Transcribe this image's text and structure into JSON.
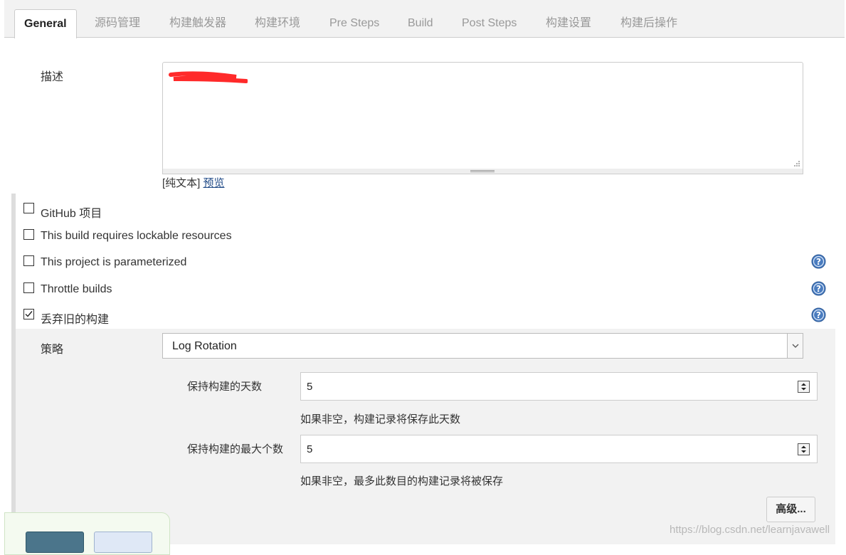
{
  "tabs": [
    {
      "label": "General",
      "active": true
    },
    {
      "label": "源码管理"
    },
    {
      "label": "构建触发器"
    },
    {
      "label": "构建环境"
    },
    {
      "label": "Pre Steps"
    },
    {
      "label": "Build"
    },
    {
      "label": "Post Steps"
    },
    {
      "label": "构建设置"
    },
    {
      "label": "构建后操作"
    }
  ],
  "description": {
    "label": "描述",
    "format_prefix": "[纯文本]",
    "preview_link": "预览"
  },
  "options": [
    {
      "label": "GitHub 项目",
      "checked": false,
      "has_help": false
    },
    {
      "label": "This build requires lockable resources",
      "checked": false,
      "has_help": false
    },
    {
      "label": "This project is parameterized",
      "checked": false,
      "has_help": true
    },
    {
      "label": "Throttle builds",
      "checked": false,
      "has_help": true
    },
    {
      "label": "丢弃旧的构建",
      "checked": true,
      "has_help": true
    }
  ],
  "discard": {
    "strategy_label": "策略",
    "strategy_value": "Log Rotation",
    "days_label": "保持构建的天数",
    "days_value": "5",
    "days_hint": "如果非空，构建记录将保存此天数",
    "max_label": "保持构建的最大个数",
    "max_value": "5",
    "max_hint": "如果非空，最多此数目的构建记录将被保存",
    "advanced_label": "高级..."
  },
  "watermark": "https://blog.csdn.net/learnjavawell",
  "colors": {
    "help_icon": "#4a7cbf",
    "save_button": "#4b758b",
    "redaction": "#ff2a2a"
  }
}
